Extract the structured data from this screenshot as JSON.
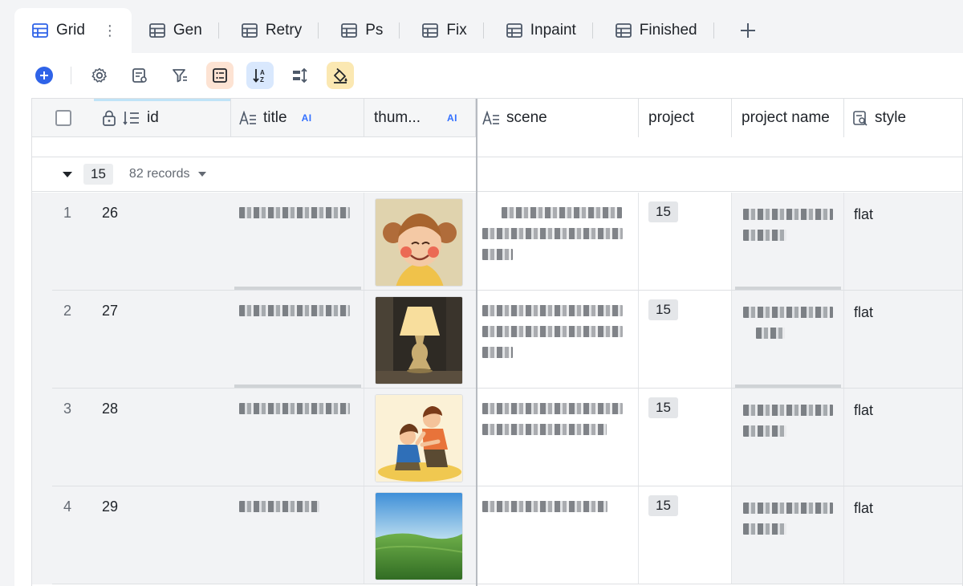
{
  "tabs": [
    {
      "label": "Grid",
      "active": true
    },
    {
      "label": "Gen"
    },
    {
      "label": "Retry"
    },
    {
      "label": "Ps"
    },
    {
      "label": "Fix"
    },
    {
      "label": "Inpaint"
    },
    {
      "label": "Finished"
    }
  ],
  "tab_menu_icon": "⋮",
  "columns": {
    "id": "id",
    "title": "title",
    "title_ai": "AI",
    "thumb": "thum...",
    "thumb_ai": "AI",
    "scene": "scene",
    "project": "project",
    "project_name": "project name",
    "style": "style"
  },
  "group": {
    "value": "15",
    "count": "82 records"
  },
  "rows": [
    {
      "num": "1",
      "id": "26",
      "thumb_icon": "girl-image",
      "project": "15",
      "style": "flat"
    },
    {
      "num": "2",
      "id": "27",
      "thumb_icon": "lamp-image",
      "project": "15",
      "style": "flat"
    },
    {
      "num": "3",
      "id": "28",
      "thumb_icon": "boys-image",
      "project": "15",
      "style": "flat"
    },
    {
      "num": "4",
      "id": "29",
      "thumb_icon": "meadow-image",
      "project": "15",
      "style": "flat"
    }
  ],
  "colors": {
    "accent": "#2f63e8",
    "ai": "#3370ff"
  }
}
